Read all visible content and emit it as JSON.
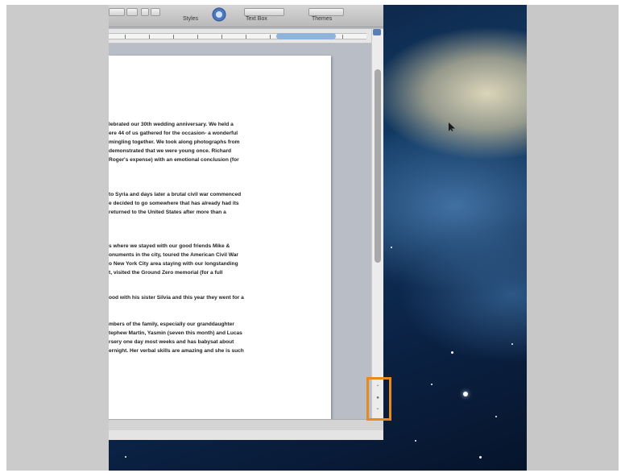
{
  "toolbar": {
    "styles_label": "Styles",
    "textbox_label": "Text Box",
    "themes_label": "Themes"
  },
  "document": {
    "paragraphs": [
      [
        "lebrated our 30th wedding anniversary.  We held a",
        "ere 44 of us gathered for the occasion- a wonderful",
        "mingling together.  We took along photographs from",
        "demonstrated that we were young once.  Richard",
        "Roger's expense) with an emotional conclusion (for"
      ],
      [
        "to Syria and days later a brutal civil war commenced",
        "e decided to go somewhere that has already had its",
        "returned to the United States after more than a"
      ],
      [
        "s where we stayed with our good friends Mike &",
        "onuments in the city, toured the American Civil War",
        "o New York City area staying with our longstanding",
        "t, visited the Ground Zero memorial (for a full"
      ],
      [
        "ood with his sister Silvia and this year they went for a"
      ],
      [
        "mbers of the family, especially our granddaughter",
        "tephew Martin, Yasmin (seven this month) and Lucas",
        "rsery one day most weeks and has babysat about",
        "ernight. Her verbal skills are amazing and she is such"
      ]
    ]
  },
  "nav_buttons": [
    "⌃",
    "●",
    "⌄"
  ],
  "colors": {
    "highlight": "#e58a1f"
  }
}
